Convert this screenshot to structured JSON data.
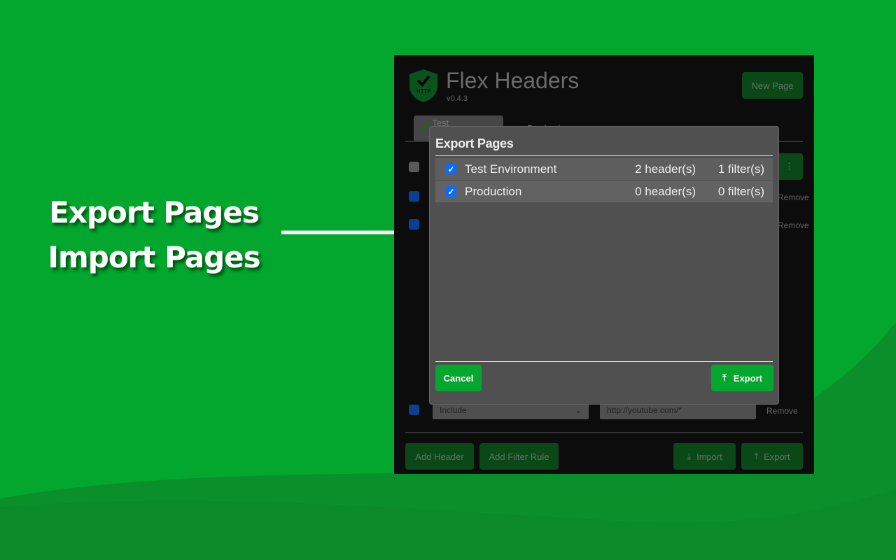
{
  "promo": {
    "line1": "Export Pages",
    "line2": "Import Pages"
  },
  "colors": {
    "background": "#03a72e",
    "accent": "#03a72e",
    "checkbox": "#0a6cff"
  },
  "app": {
    "title": "Flex Headers",
    "version": "v0.4.3",
    "logo_text": "HTTP",
    "new_page": "New Page",
    "tabs": [
      {
        "label": "Test Environment",
        "active": true
      },
      {
        "label": "Production",
        "active": false
      }
    ],
    "filter_row": {
      "mode": "Include",
      "url": "http://youtube.com/*",
      "remove": "Remove"
    },
    "remove": "Remove",
    "footer": {
      "add_header": "Add Header",
      "add_filter": "Add Filter Rule",
      "import": "Import",
      "export": "Export"
    }
  },
  "modal": {
    "title": "Export Pages",
    "pages": [
      {
        "name": "Test Environment",
        "headers": "2 header(s)",
        "filters": "1 filter(s)",
        "checked": true
      },
      {
        "name": "Production",
        "headers": "0 header(s)",
        "filters": "0 filter(s)",
        "checked": true
      }
    ],
    "cancel": "Cancel",
    "export": "Export"
  }
}
